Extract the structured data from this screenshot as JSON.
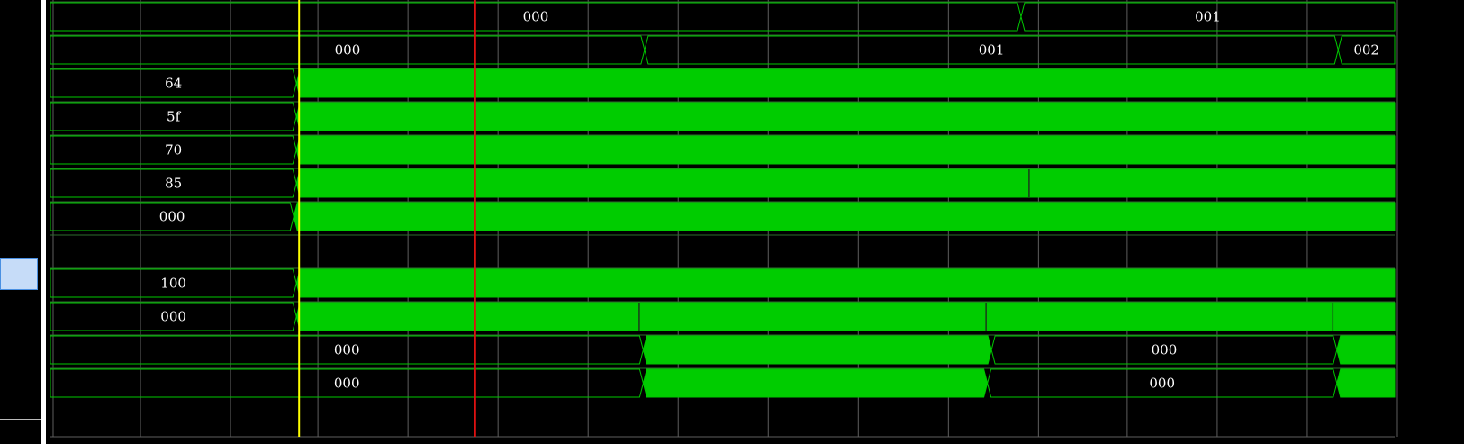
{
  "colors": {
    "background": "#000000",
    "trace": "#00c800",
    "fill": "#00cc00",
    "grid": "#5e5e5e",
    "text": "#ffffff",
    "cursor_primary": "#ffff00",
    "cursor_secondary": "#dd1111",
    "selection": "#c6dcf8"
  },
  "timeline": {
    "start": 0,
    "end": 1000
  },
  "grid_times": [
    2,
    67,
    134,
    199,
    266,
    333,
    400,
    467,
    534,
    601,
    668,
    735,
    801,
    868,
    935,
    1002
  ],
  "cursors": {
    "primary_time": 185,
    "secondary_time": 316
  },
  "rows": [
    {
      "name": "bus-row-1",
      "segments": [
        {
          "start": 0,
          "end": 722,
          "kind": "value",
          "label": "000"
        },
        {
          "start": 722,
          "end": 1000,
          "kind": "value",
          "label": "001"
        }
      ]
    },
    {
      "name": "bus-row-2",
      "segments": [
        {
          "start": 0,
          "end": 442,
          "kind": "value",
          "label": "000"
        },
        {
          "start": 442,
          "end": 958,
          "kind": "value",
          "label": "001"
        },
        {
          "start": 958,
          "end": 1000,
          "kind": "value",
          "label": "002"
        }
      ]
    },
    {
      "name": "bus-row-3",
      "segments": [
        {
          "start": 0,
          "end": 183,
          "kind": "value",
          "label": "64"
        },
        {
          "start": 183,
          "end": 1000,
          "kind": "dense",
          "label": ""
        }
      ]
    },
    {
      "name": "bus-row-4",
      "segments": [
        {
          "start": 0,
          "end": 183,
          "kind": "value",
          "label": "5f"
        },
        {
          "start": 183,
          "end": 1000,
          "kind": "dense",
          "label": ""
        }
      ]
    },
    {
      "name": "bus-row-5",
      "segments": [
        {
          "start": 0,
          "end": 183,
          "kind": "value",
          "label": "70"
        },
        {
          "start": 183,
          "end": 1000,
          "kind": "dense",
          "label": ""
        }
      ]
    },
    {
      "name": "bus-row-6",
      "segments": [
        {
          "start": 0,
          "end": 183,
          "kind": "value",
          "label": "85"
        },
        {
          "start": 183,
          "end": 1000,
          "kind": "dense",
          "label": ""
        }
      ],
      "glitches": [
        728
      ]
    },
    {
      "name": "bus-row-7",
      "segments": [
        {
          "start": 0,
          "end": 181,
          "kind": "value",
          "label": "000"
        },
        {
          "start": 181,
          "end": 1000,
          "kind": "dense",
          "label": ""
        }
      ]
    },
    {
      "name": "empty-row",
      "segments": []
    },
    {
      "name": "bus-row-9",
      "segments": [
        {
          "start": 0,
          "end": 183,
          "kind": "value",
          "label": "100"
        },
        {
          "start": 183,
          "end": 1000,
          "kind": "dense",
          "label": ""
        }
      ]
    },
    {
      "name": "bus-row-10",
      "segments": [
        {
          "start": 0,
          "end": 183,
          "kind": "value",
          "label": "000"
        },
        {
          "start": 183,
          "end": 1000,
          "kind": "dense",
          "label": ""
        }
      ],
      "glitches": [
        438,
        696,
        954
      ]
    },
    {
      "name": "bus-row-11",
      "segments": [
        {
          "start": 0,
          "end": 441,
          "kind": "value",
          "label": "000"
        },
        {
          "start": 441,
          "end": 700,
          "kind": "dense",
          "label": ""
        },
        {
          "start": 700,
          "end": 957,
          "kind": "value",
          "label": "000"
        },
        {
          "start": 957,
          "end": 1000,
          "kind": "dense",
          "label": ""
        }
      ]
    },
    {
      "name": "bus-row-12",
      "segments": [
        {
          "start": 0,
          "end": 441,
          "kind": "value",
          "label": "000"
        },
        {
          "start": 441,
          "end": 697,
          "kind": "dense",
          "label": ""
        },
        {
          "start": 697,
          "end": 957,
          "kind": "value",
          "label": "000"
        },
        {
          "start": 957,
          "end": 1000,
          "kind": "dense",
          "label": ""
        }
      ]
    }
  ]
}
